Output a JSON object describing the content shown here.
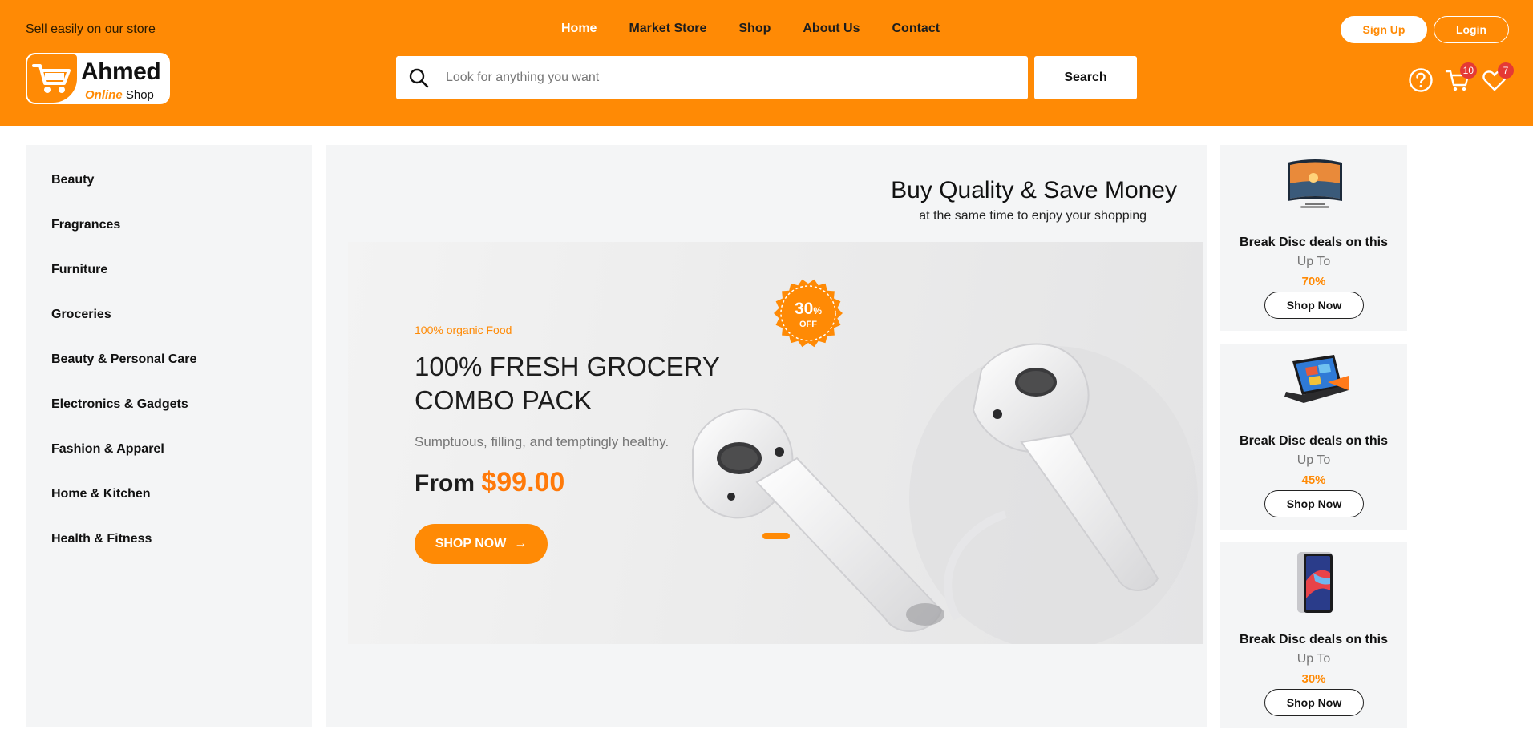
{
  "header": {
    "tagline": "Sell easily on our store",
    "nav": [
      "Home",
      "Market Store",
      "Shop",
      "About Us",
      "Contact"
    ],
    "signup_label": "Sign Up",
    "login_label": "Login",
    "logo": {
      "name": "Ahmed",
      "sub_highlight": "Online",
      "sub_rest": "Shop"
    },
    "search": {
      "placeholder": "Look for anything you want",
      "button_label": "Search"
    },
    "cart_count": "10",
    "wishlist_count": "7",
    "accent_color": "#ff8a05"
  },
  "sidebar": {
    "categories": [
      "Beauty",
      "Fragrances",
      "Furniture",
      "Groceries",
      "Beauty & Personal Care",
      "Electronics & Gadgets",
      "Fashion & Apparel",
      "Home & Kitchen",
      "Health & Fitness"
    ]
  },
  "hero": {
    "heading": "Buy Quality & Save Money",
    "subheading": "at the same time to enjoy your shopping",
    "slide": {
      "kicker": "100% organic Food",
      "title": "100% FRESH GROCERY COMBO PACK",
      "description": "Sumptuous, filling, and temptingly healthy.",
      "price_prefix": "From",
      "price": "$99.00",
      "button_label": "SHOP NOW",
      "discount_value": "30",
      "discount_unit": "%",
      "discount_label": "OFF"
    }
  },
  "deals": [
    {
      "image": "curved-tv",
      "title": "Break Disc deals on this",
      "upto": "Up To",
      "percent": "70%",
      "button_label": "Shop Now"
    },
    {
      "image": "laptop",
      "title": "Break Disc deals on this",
      "upto": "Up To",
      "percent": "45%",
      "button_label": "Shop Now"
    },
    {
      "image": "tablet",
      "title": "Break Disc deals on this",
      "upto": "Up To",
      "percent": "30%",
      "button_label": "Shop Now"
    }
  ]
}
